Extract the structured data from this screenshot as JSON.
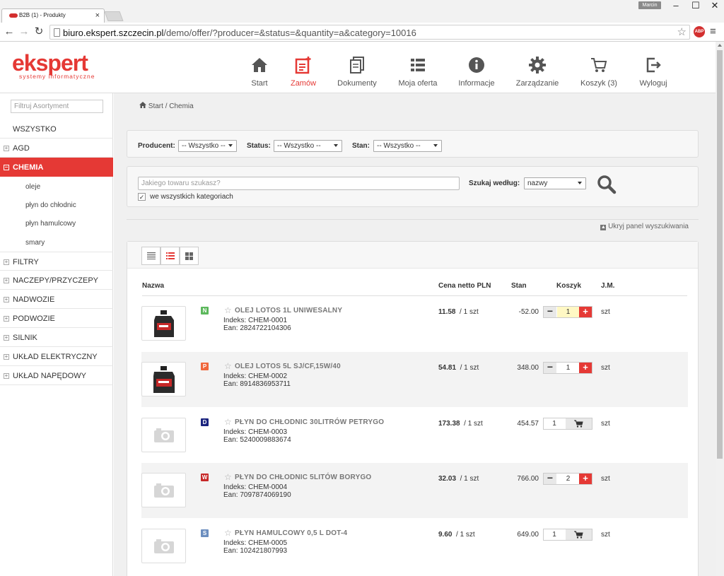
{
  "browser": {
    "tab_title": "B2B (1) - Produkty",
    "tab_close": "×",
    "user": "Marcin",
    "url_host": "biuro.ekspert.szczecin.pl",
    "url_path": "/demo/offer/?producer=&status=&quantity=a&category=10016",
    "abp": "ABP"
  },
  "logo": {
    "brand": "ekspert",
    "tagline": "systemy informatyczne"
  },
  "nav": [
    {
      "label": "Start",
      "icon": "home-icon"
    },
    {
      "label": "Zamów",
      "icon": "order-icon"
    },
    {
      "label": "Dokumenty",
      "icon": "documents-icon"
    },
    {
      "label": "Moja oferta",
      "icon": "list-icon"
    },
    {
      "label": "Informacje",
      "icon": "info-icon"
    },
    {
      "label": "Zarządzanie",
      "icon": "gear-icon"
    },
    {
      "label": "Koszyk (3)",
      "icon": "cart-icon"
    },
    {
      "label": "Wyloguj",
      "icon": "logout-icon"
    }
  ],
  "sidebar": {
    "filter_placeholder": "Filtruj Asortyment",
    "all": "WSZYSTKO",
    "categories": [
      "AGD",
      "CHEMIA",
      "FILTRY",
      "NACZEPY/PRZYCZEPY",
      "NADWOZIE",
      "PODWOZIE",
      "SILNIK",
      "UKŁAD ELEKTRYCZNY",
      "UKŁAD NAPĘDOWY"
    ],
    "active_category": "CHEMIA",
    "subcategories": [
      "oleje",
      "płyn do chłodnic",
      "płyn hamulcowy",
      "smary"
    ]
  },
  "breadcrumb": {
    "start": "Start",
    "sep": "/",
    "current": "Chemia"
  },
  "filters": {
    "producer_label": "Producent:",
    "producer_value": "-- Wszystko --",
    "status_label": "Status:",
    "status_value": "-- Wszystko --",
    "stan_label": "Stan:",
    "stan_value": "-- Wszystko --"
  },
  "search": {
    "placeholder": "Jakiego towaru szukasz?",
    "all_categories": "we wszystkich kategoriach",
    "by_label": "Szukaj według:",
    "by_value": "nazwy",
    "hide_panel": "Ukryj panel wyszukiwania"
  },
  "table": {
    "headers": {
      "name": "Nazwa",
      "price": "Cena netto PLN",
      "stock": "Stan",
      "cart": "Koszyk",
      "unit": "J.M."
    },
    "rows": [
      {
        "badge": "N",
        "badge_color": "#5cb85c",
        "name": "OLEJ LOTOS 1L UNIWESALNY",
        "index": "Indeks: CHEM-0001",
        "ean": "Ean: 2824722104306",
        "price": "11.58",
        "per": "/  1 szt",
        "stock": "-52.00",
        "qty": "1",
        "in_cart": true,
        "unit": "szt",
        "thumb": "oil-bottle-image"
      },
      {
        "badge": "P",
        "badge_color": "#f0673c",
        "name": "OLEJ LOTOS 5L SJ/CF,15W/40",
        "index": "Indeks: CHEM-0002",
        "ean": "Ean: 8914836953711",
        "price": "54.81",
        "per": "/  1 szt",
        "stock": "348.00",
        "qty": "1",
        "in_cart": true,
        "unit": "szt",
        "thumb": "oil-bottle-image"
      },
      {
        "badge": "D",
        "badge_color": "#1a237e",
        "name": "PŁYN DO CHŁODNIC 30LITRÓW PETRYGO",
        "index": "Indeks: CHEM-0003",
        "ean": "Ean: 5240009883674",
        "price": "173.38",
        "per": "/  1 szt",
        "stock": "454.57",
        "qty": "1",
        "in_cart": false,
        "unit": "szt",
        "thumb": "camera-placeholder"
      },
      {
        "badge": "W",
        "badge_color": "#c62828",
        "name": "PŁYN DO CHŁODNIC 5LITÓW BORYGO",
        "index": "Indeks: CHEM-0004",
        "ean": "Ean: 7097874069190",
        "price": "32.03",
        "per": "/  1 szt",
        "stock": "766.00",
        "qty": "2",
        "in_cart": true,
        "unit": "szt",
        "thumb": "camera-placeholder"
      },
      {
        "badge": "S",
        "badge_color": "#6c8ebf",
        "name": "PŁYN HAMULCOWY 0,5 L DOT-4",
        "index": "Indeks: CHEM-0005",
        "ean": "Ean: 102421807993",
        "price": "9.60",
        "per": "/  1 szt",
        "stock": "649.00",
        "qty": "1",
        "in_cart": false,
        "unit": "szt",
        "thumb": "camera-placeholder"
      }
    ]
  }
}
